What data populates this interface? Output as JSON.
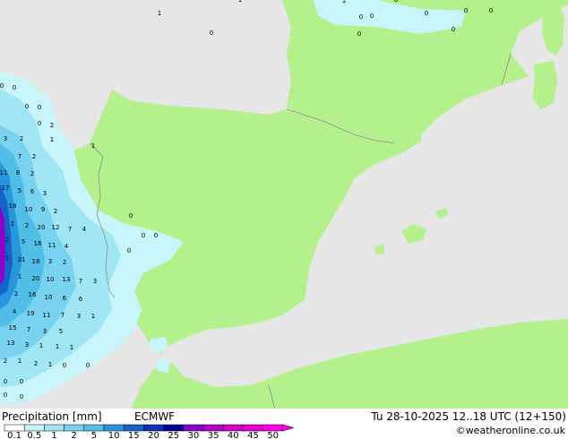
{
  "legend": {
    "title": "Precipitation [mm]",
    "model": "ECMWF",
    "valid": "Tu 28-10-2025 12..18 UTC (12+150)",
    "copyright": "©weatheronline.co.uk",
    "ticks": [
      "0.1",
      "0.5",
      "1",
      "2",
      "5",
      "10",
      "15",
      "20",
      "25",
      "30",
      "35",
      "40",
      "45",
      "50"
    ],
    "colors": [
      "#ffffff",
      "#c8f5fa",
      "#a0e6f5",
      "#78d2f0",
      "#50bee6",
      "#2896dc",
      "#1464c8",
      "#0a32b4",
      "#000096",
      "#8c00c8",
      "#b400c8",
      "#d200c8",
      "#e600d2",
      "#ff00e6"
    ]
  },
  "map": {
    "colors": {
      "sea": "#e6e6e6",
      "land_dry": "#b4f08c",
      "border": "#8c8c8c"
    },
    "values": [
      "1",
      "1",
      "0",
      "0",
      "0",
      "0",
      "0",
      "0",
      "0",
      "0",
      "1",
      "0",
      "0",
      "0",
      "0",
      "0",
      "0",
      "2",
      "1",
      "1",
      "3",
      "2",
      "7",
      "2",
      "11",
      "8",
      "2",
      "17",
      "5",
      "6",
      "3",
      "18",
      "10",
      "9",
      "2",
      "1",
      "2",
      "20",
      "12",
      "7",
      "4",
      "2",
      "5",
      "16",
      "11",
      "4",
      "1",
      "21",
      "18",
      "3",
      "2",
      "1",
      "20",
      "10",
      "13",
      "7",
      "3",
      "2",
      "16",
      "10",
      "6",
      "6",
      "4",
      "19",
      "11",
      "7",
      "3",
      "1",
      "15",
      "7",
      "3",
      "5",
      "13",
      "3",
      "1",
      "1",
      "1",
      "2",
      "1",
      "2",
      "1",
      "0",
      "0",
      "0",
      "0",
      "0",
      "0",
      "0",
      "0",
      "0",
      "0"
    ]
  }
}
